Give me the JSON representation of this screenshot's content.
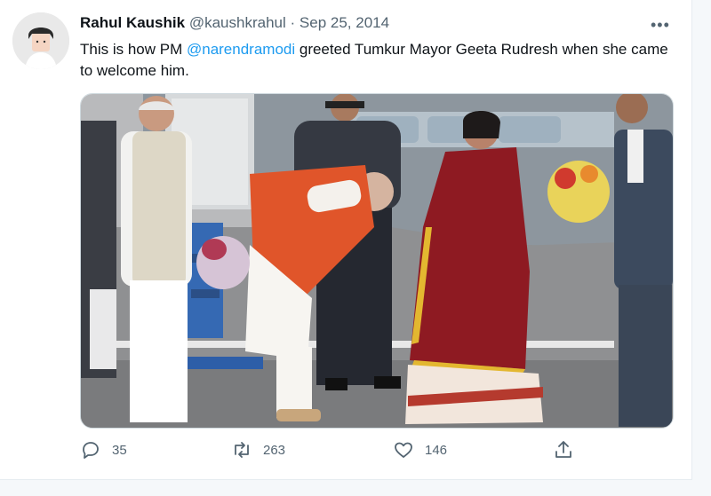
{
  "tweet": {
    "author_name": "Rahul Kaushik",
    "handle": "@kaushkrahul",
    "separator": "·",
    "date": "Sep 25, 2014",
    "text_before": "This is how PM ",
    "mention": "@narendramodi",
    "text_after": " greeted Tumkur Mayor Geeta Rudresh when she came to welcome him.",
    "more_label": "•••"
  },
  "actions": {
    "replies": "35",
    "retweets": "263",
    "likes": "146"
  },
  "icons": {
    "reply": "reply-icon",
    "retweet": "retweet-icon",
    "like": "heart-icon",
    "share": "share-icon",
    "more": "more-icon"
  },
  "colors": {
    "link": "#1d9bf0",
    "text": "#0f1419",
    "secondary": "#536471"
  }
}
